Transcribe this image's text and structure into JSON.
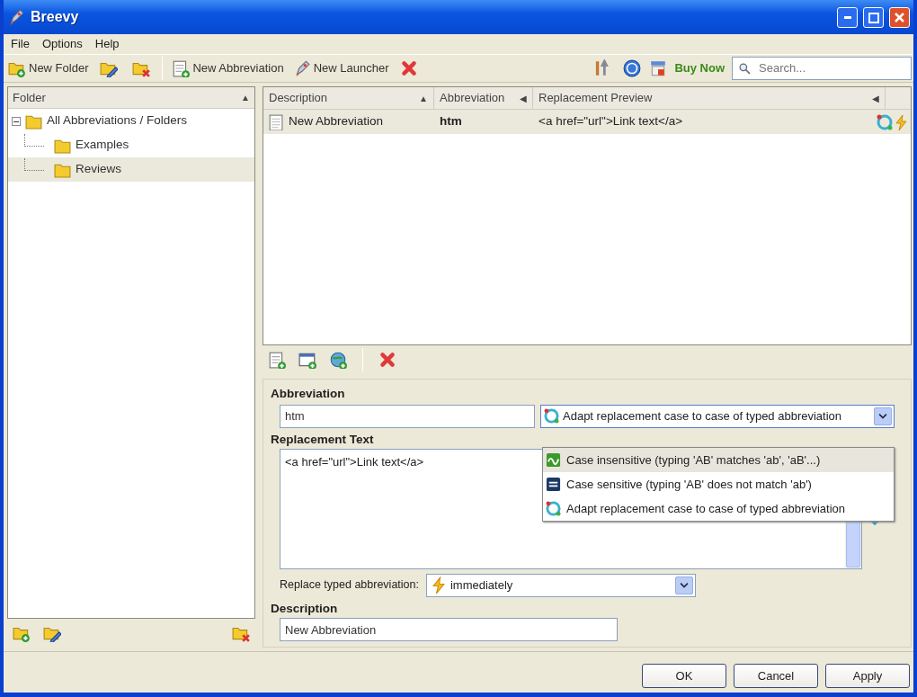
{
  "window": {
    "title": "Breevy"
  },
  "menu": [
    {
      "label": "File"
    },
    {
      "label": "Options"
    },
    {
      "label": "Help"
    }
  ],
  "toolbar": {
    "items": [
      {
        "kind": "button",
        "label": "New Folder"
      },
      {
        "kind": "icon"
      },
      {
        "kind": "icon"
      },
      {
        "kind": "separator"
      },
      {
        "kind": "button",
        "label": "New Abbreviation"
      },
      {
        "kind": "button",
        "label": "New Launcher"
      },
      {
        "kind": "icon"
      }
    ],
    "right": [
      {
        "kind": "icon"
      },
      {
        "kind": "icon"
      },
      {
        "kind": "link",
        "label": "Buy Now"
      }
    ],
    "search": {
      "placeholder": "Search..."
    }
  },
  "folder_panel": {
    "header": "Folder",
    "sort": "▲",
    "tree": [
      {
        "label": "All Abbreviations / Folders",
        "expanded": true,
        "selected": false,
        "children": [
          {
            "label": "Examples",
            "selected": false
          },
          {
            "label": "Reviews",
            "selected": true
          }
        ]
      }
    ]
  },
  "table": {
    "columns": [
      {
        "label": "Description",
        "sort": "▲"
      },
      {
        "label": "Abbreviation",
        "sort": "◀"
      },
      {
        "label": "Replacement Preview",
        "sort": "◀"
      }
    ],
    "rows": [
      {
        "description": "New Abbreviation",
        "abbreviation": "htm",
        "preview": "<a href=\"url\">Link text</a>",
        "selected": true
      }
    ]
  },
  "editor": {
    "abbreviation_label": {
      "label": "Abbreviation"
    },
    "abbreviation": "htm",
    "case_mode": {
      "current": {
        "kind": "adapt",
        "label": "Adapt replacement case to case of typed abbreviation"
      },
      "open": true,
      "options": [
        {
          "kind": "insensitive",
          "label": "Case insensitive (typing 'AB' matches 'ab', 'aB'...)",
          "selected": true
        },
        {
          "kind": "sensitive",
          "label": "Case sensitive (typing 'AB' does not match 'ab')",
          "selected": false
        },
        {
          "kind": "adapt",
          "label": "Adapt replacement case to case of typed abbreviation",
          "selected": false
        }
      ]
    },
    "replacement_label": {
      "label": "Replacement Text"
    },
    "replacement": "<a href=\"url\">Link text</a>",
    "replace_label": {
      "label": "Replace typed abbreviation:"
    },
    "replace_mode": "immediately",
    "description_label": {
      "label": "Description"
    },
    "description": "New Abbreviation"
  },
  "buttons": [
    "OK",
    "Cancel",
    "Apply"
  ]
}
